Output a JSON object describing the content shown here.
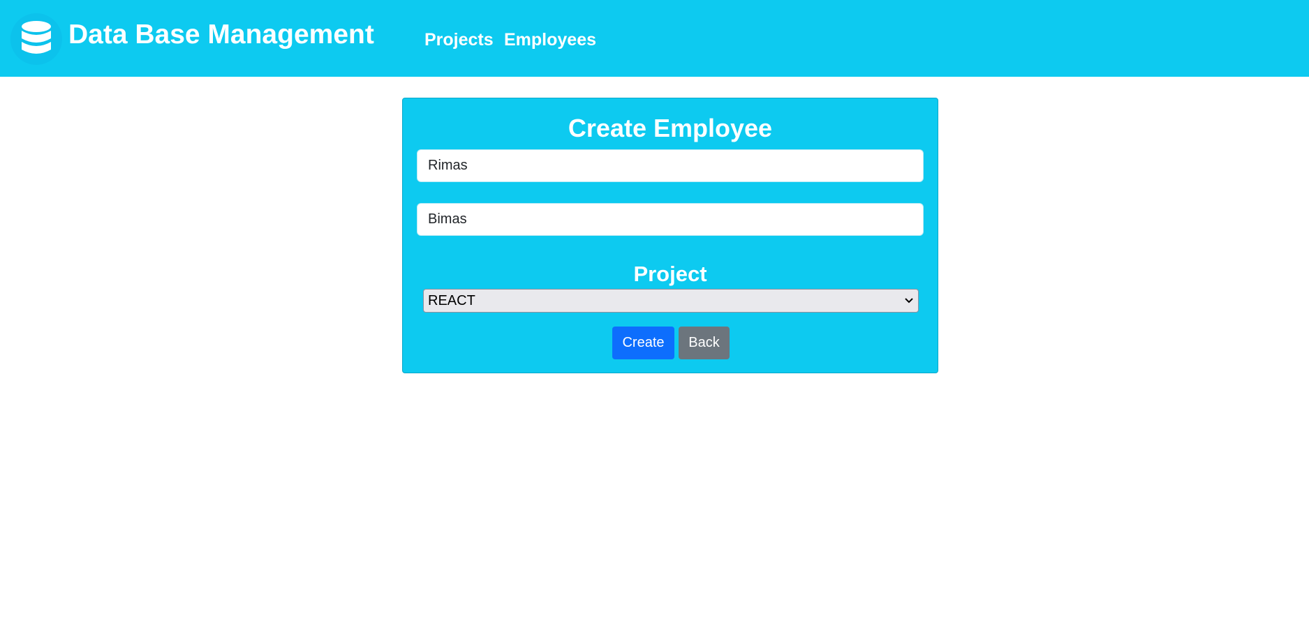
{
  "header": {
    "brand_icon": "database-icon",
    "title": "Data Base Management",
    "nav": [
      {
        "label": "Projects"
      },
      {
        "label": "Employees"
      }
    ]
  },
  "form": {
    "title": "Create Employee",
    "first_name_value": "Rimas",
    "last_name_value": "Bimas",
    "project_label": "Project",
    "project_selected": "REACT",
    "create_label": "Create",
    "back_label": "Back"
  },
  "colors": {
    "header_bg": "#0dcaf0",
    "card_bg": "#0dcaf0",
    "primary": "#0d6efd",
    "secondary": "#6c757d"
  }
}
